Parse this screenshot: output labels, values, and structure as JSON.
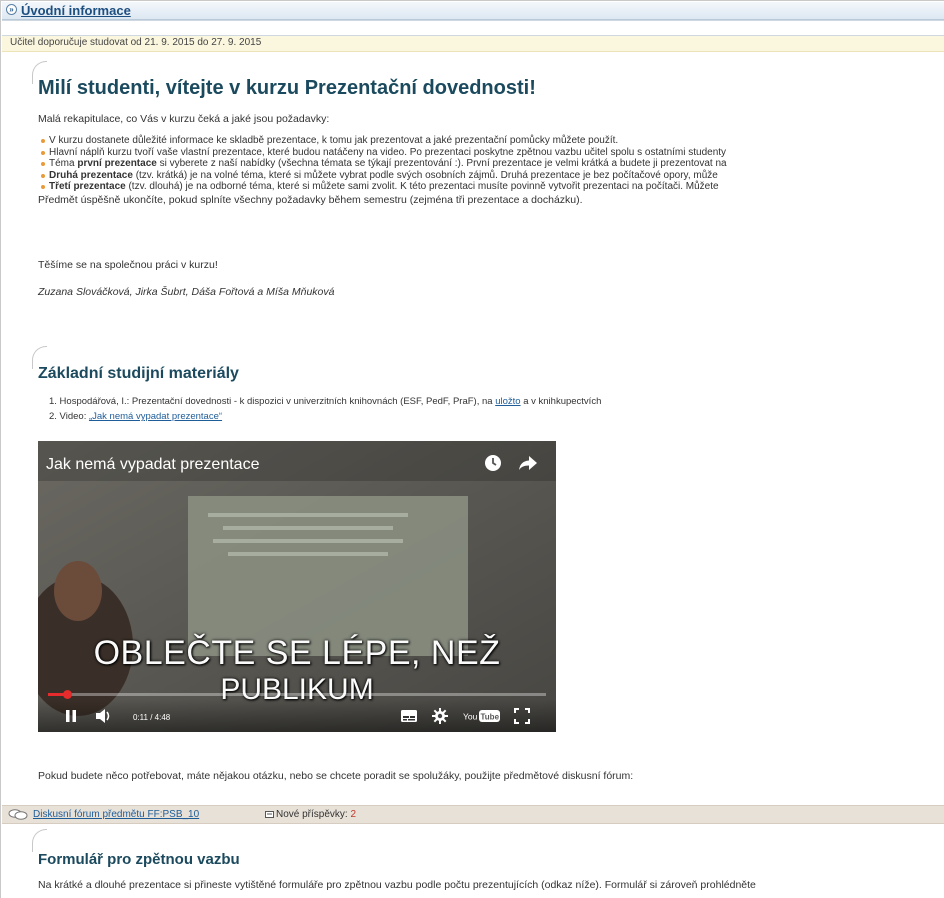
{
  "header": {
    "title": "Úvodní informace"
  },
  "study_dates": "Učitel doporučuje studovat od 21. 9. 2015 do 27. 9. 2015",
  "welcome": {
    "heading": "Milí studenti, vítejte v kurzu Prezentační dovednosti!",
    "intro": "Malá rekapitulace, co Vás v kurzu čeká a jaké jsou požadavky:",
    "bullets": [
      {
        "bold": "",
        "text": "V kurzu dostanete důležité informace ke skladbě prezentace, k tomu jak prezentovat a jaké prezentační pomůcky můžete použít."
      },
      {
        "bold": "",
        "text": "Hlavní náplň kurzu tvoří vaše vlastní prezentace, které budou natáčeny na video. Po prezentaci poskytne zpětnou vazbu učitel spolu s ostatními studenty"
      },
      {
        "pre": "Téma ",
        "bold": "první prezentace",
        "text": " si vyberete z naší nabídky (všechna témata se týkají prezentování :). První prezentace je velmi krátká a budete ji prezentovat na"
      },
      {
        "pre": "",
        "bold": "Druhá prezentace",
        "text": " (tzv. krátká) je na volné téma, které si můžete vybrat podle svých osobních zájmů. Druhá prezentace je bez počítačové opory, může"
      },
      {
        "pre": "",
        "bold": "Třetí prezentace",
        "text": " (tzv. dlouhá) je na odborné téma, které si můžete sami zvolit. K této prezentaci musíte povinně vytvořit prezentaci na počítači. Můžete"
      }
    ],
    "completion": "Předmět úspěšně ukončíte, pokud splníte všechny požadavky během semestru (zejména tři prezentace a docházku).",
    "closing": "Těšíme se na společnou práci v kurzu!",
    "signature": "Zuzana Slováčková, Jirka Šubrt, Dáša Fořtová a Míša Mňuková"
  },
  "materials": {
    "heading": "Základní studijní materiály",
    "item1_prefix": "1. Hospodářová, I.: Prezentační dovednosti - k dispozici v univerzitních knihovnách (ESF, PedF, PraF), na ",
    "item1_link": "uložto",
    "item1_suffix": " a v knihkupectvích",
    "item2_prefix": "2. Video: ",
    "item2_link": "„Jak nemá vypadat prezentace“"
  },
  "video": {
    "title": "Jak nemá vypadat prezentace",
    "caption_line1": "OBLEČTE SE LÉPE, NEŽ",
    "caption_line2": "PUBLIKUM",
    "time": "0:11 / 4:48",
    "progress": 0.038,
    "icons": [
      "clock-icon",
      "share-icon",
      "pause-icon",
      "volume-icon",
      "captions-icon",
      "settings-icon",
      "youtube-logo",
      "fullscreen-icon"
    ]
  },
  "forum_intro": "Pokud budete něco potřebovat, máte nějakou otázku, nebo se chcete poradit se spolužáky, použijte předmětové diskusní fórum:",
  "forum": {
    "link": "Diskusní fórum předmětu FF:PSB_10",
    "new_label": "Nové příspěvky: ",
    "new_count": "2"
  },
  "feedback": {
    "heading": "Formulář pro zpětnou vazbu",
    "text": "Na krátké a dlouhé prezentace si přineste vytištěné formuláře pro zpětnou vazbu podle počtu prezentujících (odkaz níže). Formulář si zároveň prohlédněte"
  },
  "colors": {
    "heading": "#1b4a5e",
    "link": "#1f5d99",
    "bullet": "#e89b3a",
    "youtube_red": "#e52b2b"
  }
}
